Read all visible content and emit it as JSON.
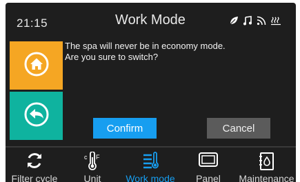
{
  "status_bar": {
    "time": "21:15",
    "title": "Work Mode",
    "icons": [
      "leaf-icon",
      "music-icon",
      "wifi-icon",
      "heater-icon"
    ]
  },
  "dialog": {
    "message_line1": "The spa will never be in economy mode.",
    "message_line2": "Are you sure to switch?",
    "confirm_label": "Confirm",
    "cancel_label": "Cancel"
  },
  "sidebar": {
    "home_icon": "home-icon",
    "back_icon": "back-arrow-icon"
  },
  "nav": {
    "items": [
      {
        "label": "Filter cycle",
        "icon": "refresh-icon",
        "active": false
      },
      {
        "label": "Unit",
        "icon": "thermometer-icon",
        "active": false
      },
      {
        "label": "Work mode",
        "icon": "work-mode-icon",
        "active": true
      },
      {
        "label": "Panel",
        "icon": "panel-icon",
        "active": false
      },
      {
        "label": "Maintenance",
        "icon": "maintenance-icon",
        "active": false
      }
    ]
  },
  "colors": {
    "background": "#1e1e1e",
    "home_button": "#f5a623",
    "back_button": "#0fb39f",
    "confirm_button": "#179ef0",
    "cancel_button": "#5b5b5b",
    "active_nav": "#179ef0"
  }
}
